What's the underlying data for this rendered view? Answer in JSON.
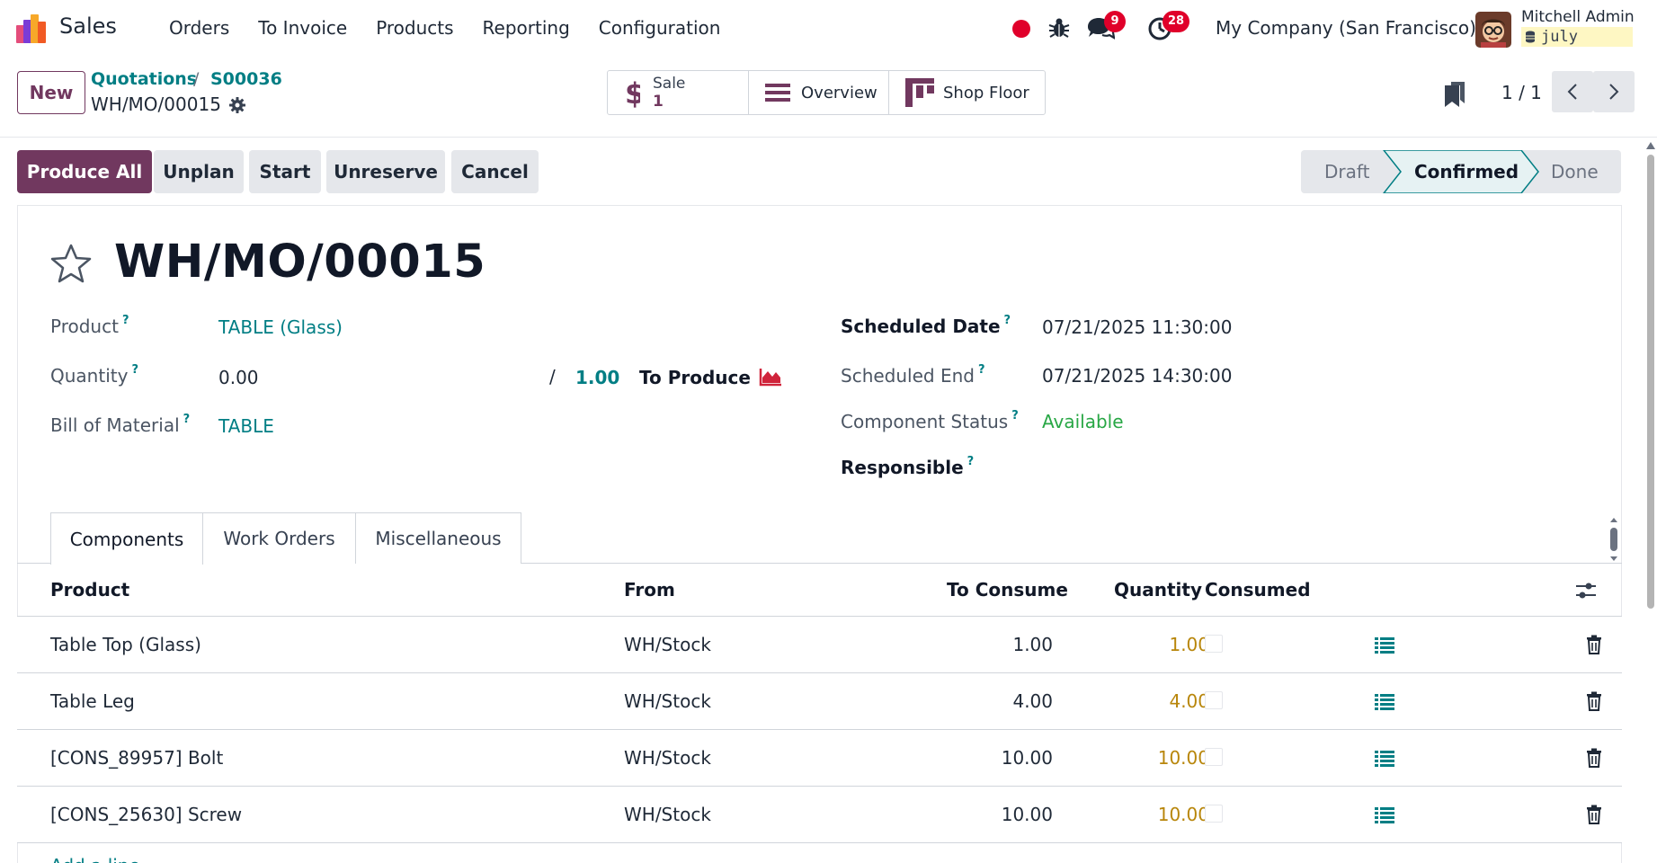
{
  "navbar": {
    "app_name": "Sales",
    "menu": [
      "Orders",
      "To Invoice",
      "Products",
      "Reporting",
      "Configuration"
    ],
    "chat_count": "9",
    "activity_count": "28",
    "company": "My Company (San Francisco)",
    "user_name": "Mitchell Admin",
    "database": "july"
  },
  "control": {
    "new_label": "New",
    "breadcrumb": [
      "Quotations",
      "S00036"
    ],
    "breadcrumb_sep": "/",
    "current": "WH/MO/00015",
    "smart_buttons": {
      "sale_label": "Sale",
      "sale_count": "1",
      "overview_label": "Overview",
      "shopfloor_label": "Shop Floor"
    },
    "pager": "1 / 1"
  },
  "actions": {
    "produce_all": "Produce All",
    "unplan": "Unplan",
    "start": "Start",
    "unreserve": "Unreserve",
    "cancel": "Cancel"
  },
  "status": {
    "steps": [
      "Draft",
      "Confirmed",
      "Done"
    ],
    "current": "Confirmed"
  },
  "form": {
    "title": "WH/MO/00015",
    "help_mark": "?",
    "product_label": "Product",
    "product_value": "TABLE (Glass)",
    "quantity_label": "Quantity",
    "quantity_value": "0.00",
    "quantity_sep": "/",
    "quantity_to_produce": "1.00",
    "to_produce_label": "To Produce",
    "bom_label": "Bill of Material",
    "bom_value": "TABLE",
    "scheduled_date_label": "Scheduled Date",
    "scheduled_date_value": "07/21/2025 11:30:00",
    "scheduled_end_label": "Scheduled End",
    "scheduled_end_value": "07/21/2025 14:30:00",
    "component_status_label": "Component Status",
    "component_status_value": "Available",
    "responsible_label": "Responsible"
  },
  "tabs": [
    "Components",
    "Work Orders",
    "Miscellaneous"
  ],
  "table": {
    "headers": {
      "product": "Product",
      "from": "From",
      "to_consume": "To Consume",
      "quantity": "Quantity",
      "consumed": "Consumed"
    },
    "rows": [
      {
        "product": "Table Top (Glass)",
        "from": "WH/Stock",
        "to_consume": "1.00",
        "quantity": "1.00"
      },
      {
        "product": "Table Leg",
        "from": "WH/Stock",
        "to_consume": "4.00",
        "quantity": "4.00"
      },
      {
        "product": "[CONS_89957] Bolt",
        "from": "WH/Stock",
        "to_consume": "10.00",
        "quantity": "10.00"
      },
      {
        "product": "[CONS_25630] Screw",
        "from": "WH/Stock",
        "to_consume": "10.00",
        "quantity": "10.00"
      }
    ],
    "add_line": "Add a line"
  },
  "colors": {
    "brand": "#71385f",
    "link": "#017e84",
    "available": "#28a745",
    "quantity": "#b8860b",
    "badge": "#e0002a"
  }
}
